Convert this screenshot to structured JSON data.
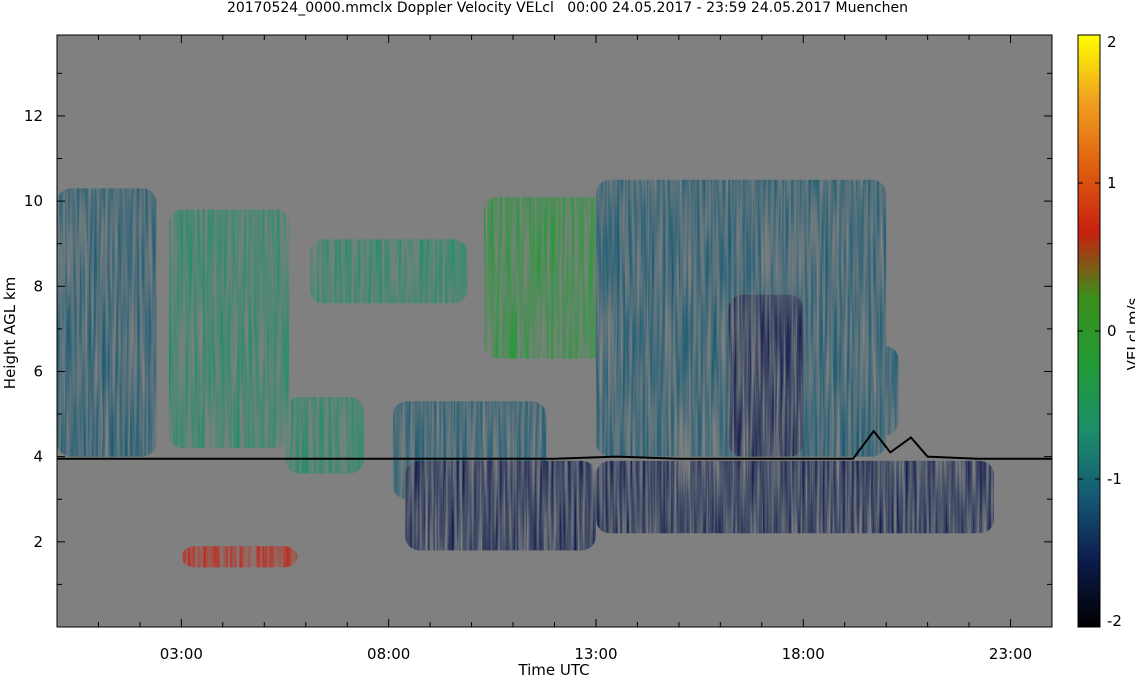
{
  "chart_data": {
    "type": "heatmap",
    "title": "20170524_0000.mmclx Doppler Velocity VELcl   00:00 24.05.2017 - 23:59 24.05.2017 Muenchen",
    "xlabel": "Time UTC",
    "ylabel": "Height AGL km",
    "xlim": [
      0.0,
      24.0
    ],
    "ylim": [
      0.0,
      13.9
    ],
    "x_ticks": [
      "03:00",
      "08:00",
      "13:00",
      "18:00",
      "23:00"
    ],
    "x_tick_values": [
      3,
      8,
      13,
      18,
      23
    ],
    "y_ticks": [
      "2",
      "4",
      "6",
      "8",
      "10",
      "12"
    ],
    "y_tick_values": [
      2,
      4,
      6,
      8,
      10,
      12
    ],
    "background_color": "#808080",
    "colorbar": {
      "label": "VELcl m/s",
      "range": [
        -2,
        2
      ],
      "ticks": [
        "2",
        "1",
        "0",
        "-1",
        "-2"
      ],
      "tick_values": [
        2,
        1,
        0,
        -1,
        -2
      ],
      "colors": [
        "#000000",
        "#0c1b4d",
        "#155a74",
        "#1c8e6a",
        "#229a35",
        "#3a8f1c",
        "#c82010",
        "#e06010",
        "#f0a020",
        "#ffff00"
      ]
    },
    "echo_regions": [
      {
        "t0": 0.0,
        "t1": 2.4,
        "h0": 4.0,
        "h1": 10.3,
        "mean_velocity": -0.9
      },
      {
        "t0": 2.7,
        "t1": 5.6,
        "h0": 4.2,
        "h1": 9.8,
        "mean_velocity": -0.6
      },
      {
        "t0": 5.5,
        "t1": 7.4,
        "h0": 3.6,
        "h1": 5.4,
        "mean_velocity": -0.8
      },
      {
        "t0": 6.1,
        "t1": 9.9,
        "h0": 7.6,
        "h1": 9.1,
        "mean_velocity": -0.5
      },
      {
        "t0": 8.1,
        "t1": 11.8,
        "h0": 3.0,
        "h1": 5.3,
        "mean_velocity": -0.9
      },
      {
        "t0": 8.4,
        "t1": 13.0,
        "h0": 1.8,
        "h1": 3.9,
        "mean_velocity": -1.5
      },
      {
        "t0": 10.3,
        "t1": 13.2,
        "h0": 6.3,
        "h1": 10.1,
        "mean_velocity": -0.2
      },
      {
        "t0": 13.0,
        "t1": 20.0,
        "h0": 4.0,
        "h1": 10.5,
        "mean_velocity": -0.9
      },
      {
        "t0": 16.2,
        "t1": 18.0,
        "h0": 4.0,
        "h1": 7.8,
        "mean_velocity": -1.7
      },
      {
        "t0": 18.3,
        "t1": 20.3,
        "h0": 4.5,
        "h1": 6.6,
        "mean_velocity": -0.9
      },
      {
        "t0": 13.0,
        "t1": 22.6,
        "h0": 2.2,
        "h1": 3.9,
        "mean_velocity": -1.4
      },
      {
        "t0": 3.0,
        "t1": 5.8,
        "h0": 1.4,
        "h1": 1.9,
        "mean_velocity": 0.5
      }
    ],
    "overlay_line": {
      "name": "",
      "color": "#000000",
      "points": [
        [
          0,
          3.95
        ],
        [
          12,
          3.95
        ],
        [
          13.5,
          4.0
        ],
        [
          15,
          3.95
        ],
        [
          19.2,
          3.95
        ],
        [
          19.7,
          4.6
        ],
        [
          20.1,
          4.1
        ],
        [
          20.6,
          4.45
        ],
        [
          21.0,
          4.0
        ],
        [
          22.2,
          3.95
        ],
        [
          24,
          3.95
        ]
      ]
    }
  }
}
